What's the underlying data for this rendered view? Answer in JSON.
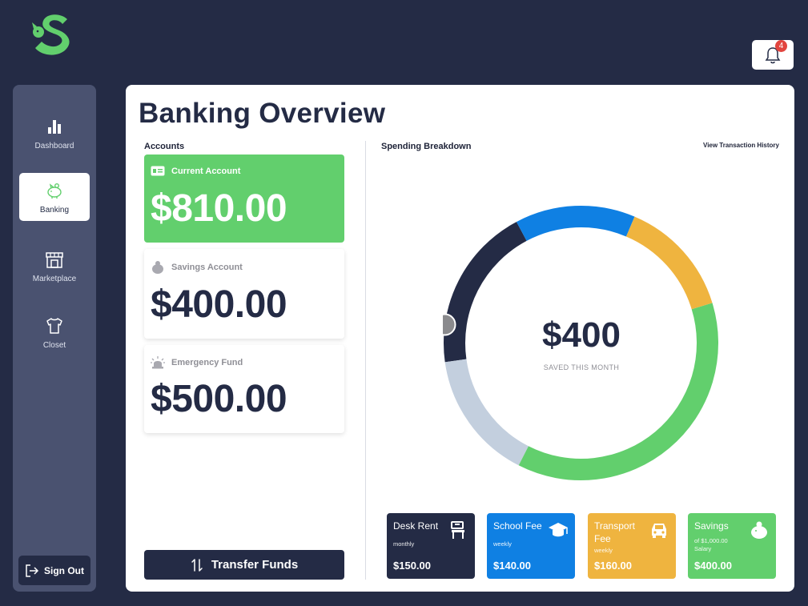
{
  "header": {
    "notification_count": "4"
  },
  "sidebar": {
    "items": [
      {
        "label": "Dashboard",
        "icon": "bar-chart-icon"
      },
      {
        "label": "Banking",
        "icon": "piggy-bank-icon",
        "active": true
      },
      {
        "label": "Marketplace",
        "icon": "store-icon"
      },
      {
        "label": "Closet",
        "icon": "shirt-icon"
      }
    ],
    "sign_out_label": "Sign Out"
  },
  "main": {
    "title": "Banking Overview",
    "accounts_label": "Accounts",
    "spending_label": "Spending Breakdown",
    "view_history_label": "View Transaction History",
    "accounts": [
      {
        "name": "Current Account",
        "amount": "$810.00",
        "icon": "id-card-icon"
      },
      {
        "name": "Savings Account",
        "amount": "$400.00",
        "icon": "piggy-bank-icon"
      },
      {
        "name": "Emergency Fund",
        "amount": "$500.00",
        "icon": "siren-icon"
      }
    ],
    "transfer_label": "Transfer Funds",
    "donut": {
      "center_amount": "$400",
      "center_label": "SAVED THIS MONTH"
    },
    "tiles": [
      {
        "title": "Desk Rent",
        "sub": "monthly",
        "sub2": "",
        "amount": "$150.00",
        "icon": "desk-icon",
        "color": "#242b45"
      },
      {
        "title": "School Fee",
        "sub": "weekly",
        "sub2": "",
        "amount": "$140.00",
        "icon": "graduation-cap-icon",
        "color": "#0f80e3"
      },
      {
        "title": "Transport Fee",
        "sub": "weekly",
        "sub2": "",
        "amount": "$160.00",
        "icon": "car-icon",
        "color": "#efb43f"
      },
      {
        "title": "Savings",
        "sub": "of $1,000.00",
        "sub2": "Salary",
        "amount": "$400.00",
        "icon": "piggy-bank-icon",
        "color": "#62cf6d"
      }
    ]
  },
  "colors": {
    "navy": "#242b45",
    "blue": "#0f80e3",
    "yellow": "#efb43f",
    "green": "#62cf6d",
    "light": "#c3cfde"
  }
}
